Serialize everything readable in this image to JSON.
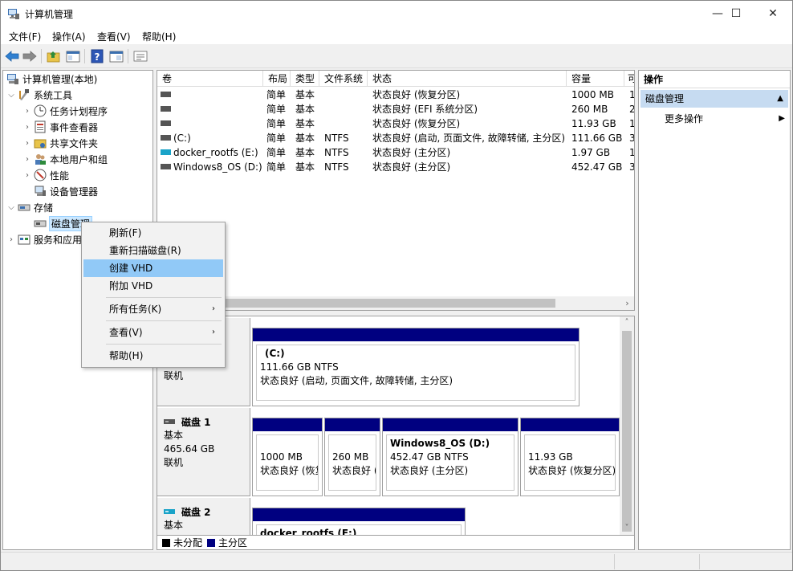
{
  "window": {
    "title": "计算机管理",
    "controls": {
      "minimize": "—",
      "maximize": "☐",
      "close": "✕"
    }
  },
  "menu": [
    "文件(F)",
    "操作(A)",
    "查看(V)",
    "帮助(H)"
  ],
  "toolbar": {
    "icons": [
      "back-icon",
      "forward-icon",
      "up-folder-icon",
      "show-hide-tree-icon",
      "help-icon",
      "properties-icon",
      "console-icon"
    ]
  },
  "tree": {
    "root": "计算机管理(本地)",
    "system_tools": "系统工具",
    "task_scheduler": "任务计划程序",
    "event_viewer": "事件查看器",
    "shared_folders": "共享文件夹",
    "local_users": "本地用户和组",
    "performance": "性能",
    "device_manager": "设备管理器",
    "storage": "存储",
    "disk_management": "磁盘管理",
    "services": "服务和应用程序"
  },
  "volumes": {
    "columns": [
      "卷",
      "布局",
      "类型",
      "文件系统",
      "状态",
      "容量",
      "可"
    ],
    "rows": [
      {
        "vol": "",
        "layout": "简单",
        "type": "基本",
        "fs": "",
        "status": "状态良好 (恢复分区)",
        "cap": "1000 MB",
        "free": "1"
      },
      {
        "vol": "",
        "layout": "简单",
        "type": "基本",
        "fs": "",
        "status": "状态良好 (EFI 系统分区)",
        "cap": "260 MB",
        "free": "2"
      },
      {
        "vol": "",
        "layout": "简单",
        "type": "基本",
        "fs": "",
        "status": "状态良好 (恢复分区)",
        "cap": "11.93 GB",
        "free": "1"
      },
      {
        "vol": "(C:)",
        "layout": "简单",
        "type": "基本",
        "fs": "NTFS",
        "status": "状态良好 (启动, 页面文件, 故障转储, 主分区)",
        "cap": "111.66 GB",
        "free": "3"
      },
      {
        "vol": "docker_rootfs (E:)",
        "layout": "简单",
        "type": "基本",
        "fs": "NTFS",
        "status": "状态良好 (主分区)",
        "cap": "1.97 GB",
        "free": "1"
      },
      {
        "vol": "Windows8_OS (D:)",
        "layout": "简单",
        "type": "基本",
        "fs": "NTFS",
        "status": "状态良好 (主分区)",
        "cap": "452.47 GB",
        "free": "3"
      }
    ]
  },
  "disks": {
    "disk0": {
      "status": "联机",
      "partition": {
        "name": "(C:)",
        "size": "111.66 GB NTFS",
        "status": "状态良好 (启动, 页面文件, 故障转储, 主分区)"
      }
    },
    "disk1": {
      "name": "磁盘 1",
      "type": "基本",
      "size": "465.64 GB",
      "status": "联机",
      "partitions": [
        {
          "name": "",
          "size": "1000 MB",
          "status": "状态良好 (恢复"
        },
        {
          "name": "",
          "size": "260 MB",
          "status": "状态良好 ("
        },
        {
          "name": "Windows8_OS  (D:)",
          "size": "452.47 GB NTFS",
          "status": "状态良好 (主分区)"
        },
        {
          "name": "",
          "size": "11.93 GB",
          "status": "状态良好 (恢复分区)"
        }
      ]
    },
    "disk2": {
      "name": "磁盘 2",
      "type": "基本",
      "partition": {
        "name": "docker_rootfs  (E:)"
      }
    }
  },
  "legend": [
    {
      "label": "未分配",
      "color": "#000000"
    },
    {
      "label": "主分区",
      "color": "#000080"
    }
  ],
  "actions": {
    "header": "操作",
    "group": "磁盘管理",
    "more": "更多操作"
  },
  "context_menu": {
    "refresh": "刷新(F)",
    "rescan": "重新扫描磁盘(R)",
    "create_vhd": "创建 VHD",
    "attach_vhd": "附加 VHD",
    "all_tasks": "所有任务(K)",
    "view": "查看(V)",
    "help": "帮助(H)"
  }
}
